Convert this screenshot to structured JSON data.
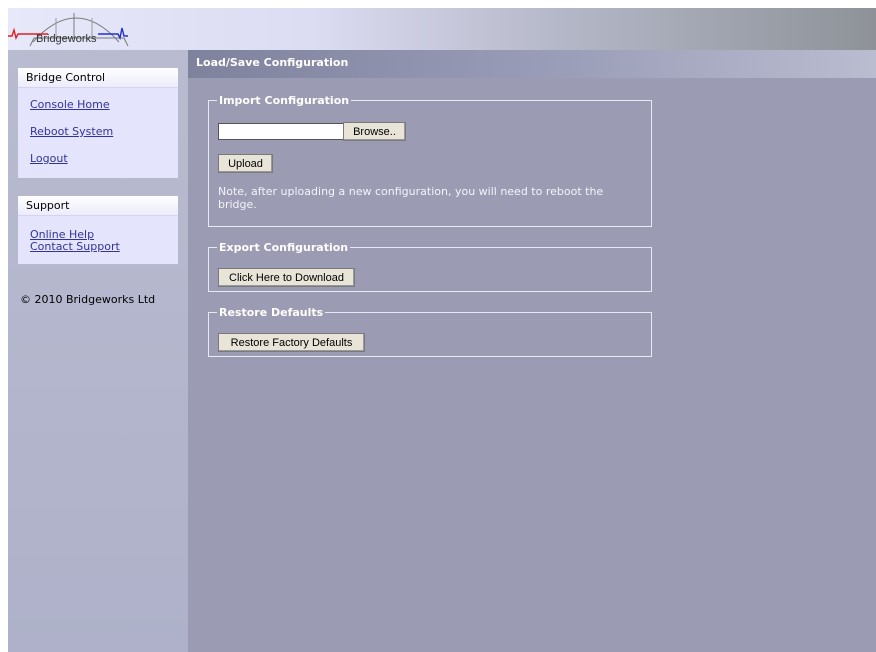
{
  "header": {
    "logo_text": "Bridgeworks"
  },
  "sidebar": {
    "bridge_control": {
      "title": "Bridge Control",
      "links": [
        "Console Home",
        "Reboot System",
        "Logout"
      ]
    },
    "support": {
      "title": "Support",
      "links": [
        "Online Help",
        "Contact Support"
      ]
    },
    "copyright": "© 2010 Bridgeworks Ltd"
  },
  "main": {
    "page_title": "Load/Save Configuration",
    "import": {
      "legend": "Import Configuration",
      "file_value": "",
      "browse_label": "Browse..",
      "upload_label": "Upload",
      "note": "Note, after uploading a new configuration, you will need to reboot the bridge."
    },
    "export": {
      "legend": "Export Configuration",
      "download_label": "Click Here to Download"
    },
    "restore": {
      "legend": "Restore Defaults",
      "restore_label": "Restore Factory Defaults"
    }
  },
  "colors": {
    "content_bg": "#9b9bb3",
    "sidebar_bg": "#b9bbd0",
    "link": "#333399",
    "logo_red": "#e02020",
    "logo_blue": "#2030d0"
  }
}
